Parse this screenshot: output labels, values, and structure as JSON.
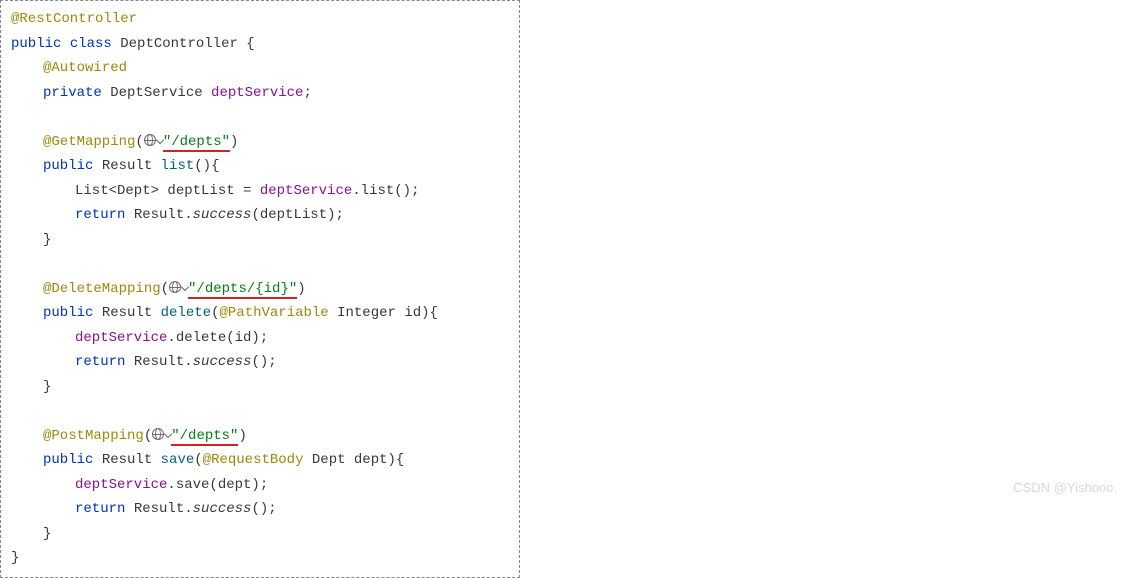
{
  "code": {
    "ann_rest": "@RestController",
    "kw_public": "public",
    "kw_class": "class",
    "cls_name": "DeptController",
    "brace_open": " {",
    "ann_autowired": "@Autowired",
    "kw_private": "private",
    "type_deptservice": "DeptService",
    "field_deptservice": "deptService",
    "semi": ";",
    "ann_getmapping": "@GetMapping",
    "paren_open": "(",
    "paren_close": ")",
    "str_depts": "\"/depts\"",
    "type_result": "Result",
    "m_list": "list",
    "sig_list": "(){",
    "line_listdecl_a": "List<Dept> deptList = ",
    "m_dot_list": ".list",
    "line_listdecl_b": "();",
    "kw_return": "return",
    "ret_success_a": " Result.",
    "ret_success_m": "success",
    "ret_success_b1": "(deptList);",
    "ret_success_b2": "();",
    "brace_close": "}",
    "ann_deletemapping": "@DeleteMapping",
    "str_depts_id": "\"/depts/{id}\"",
    "m_delete": "delete",
    "ann_pathvar": "@PathVariable",
    "sig_delete_b": " Integer id){",
    "call_delete": ".delete(id);",
    "ann_postmapping": "@PostMapping",
    "m_save": "save",
    "ann_reqbody": "@RequestBody",
    "sig_save_b": " Dept dept){",
    "call_save": ".save(dept);"
  },
  "watermark": "CSDN @Yishooo."
}
